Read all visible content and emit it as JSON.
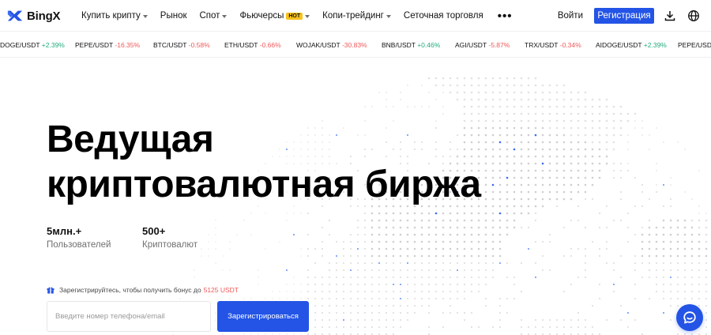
{
  "brand": {
    "name": "BingX",
    "accent": "#2354e6"
  },
  "nav": {
    "items": [
      {
        "label": "Купить крипту",
        "dropdown": true
      },
      {
        "label": "Рынок",
        "dropdown": false
      },
      {
        "label": "Спот",
        "dropdown": true
      },
      {
        "label": "Фьючерсы",
        "dropdown": true,
        "badge": "HOT"
      },
      {
        "label": "Копи-трейдинг",
        "dropdown": true
      },
      {
        "label": "Сеточная торговля",
        "dropdown": false
      }
    ],
    "more": "•••"
  },
  "header_right": {
    "login": "Войти",
    "signup": "Регистрация",
    "download_icon": "download-icon",
    "language_icon": "globe-icon"
  },
  "ticker": [
    {
      "pair": "AIDOGE/USDT",
      "change": "+2.39%",
      "trend": "up"
    },
    {
      "pair": "PEPE/USDT",
      "change": "-16.35%",
      "trend": "down"
    },
    {
      "pair": "BTC/USDT",
      "change": "-0.58%",
      "trend": "down"
    },
    {
      "pair": "ETH/USDT",
      "change": "-0.66%",
      "trend": "down"
    },
    {
      "pair": "WOJAK/USDT",
      "change": "-30.83%",
      "trend": "down"
    },
    {
      "pair": "BNB/USDT",
      "change": "+0.46%",
      "trend": "up"
    },
    {
      "pair": "AGI/USDT",
      "change": "-5.87%",
      "trend": "down"
    },
    {
      "pair": "TRX/USDT",
      "change": "-0.34%",
      "trend": "down"
    },
    {
      "pair": "AIDOGE/USDT",
      "change": "+2.39%",
      "trend": "up"
    },
    {
      "pair": "PEPE/USDT",
      "change": "",
      "trend": "down"
    }
  ],
  "hero": {
    "title_line1": "Ведущая",
    "title_line2": "криптовалютная биржа"
  },
  "stats": [
    {
      "value": "5млн.+",
      "label": "Пользователей"
    },
    {
      "value": "500+",
      "label": "Криптовалют"
    }
  ],
  "signup_form": {
    "bonus_text": "Зарегистрируйтесь, чтобы получить бонус до",
    "bonus_amount": "5125 USDT",
    "phone_placeholder": "Введите номер телефона/email",
    "register_button": "Зарегистрироваться"
  },
  "chat": {
    "icon": "chat-icon"
  },
  "colors": {
    "up": "#22ac79",
    "down": "#f15858",
    "hot_badge": "#f7c21b"
  }
}
